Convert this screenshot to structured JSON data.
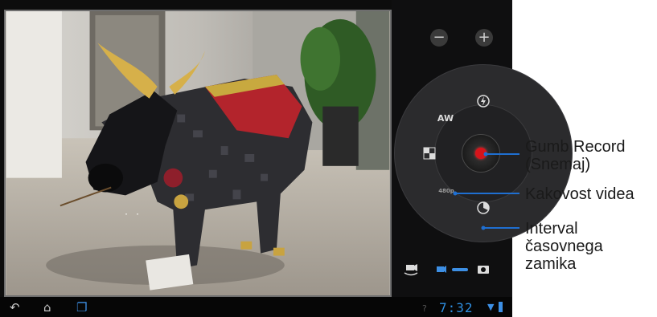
{
  "camera": {
    "zoom_out_label": "−",
    "zoom_in_label": "+",
    "focus_indicator": "· ·",
    "controls": {
      "flash_icon": "flash-auto-icon",
      "white_balance_label": "AW",
      "scene_icon": "color-effect-icon",
      "video_quality_label": "480p",
      "timelapse_icon": "timelapse-icon"
    },
    "mode": {
      "current": "video",
      "options": [
        "video",
        "photo"
      ]
    }
  },
  "status_bar": {
    "time": "7:32",
    "nav": [
      "back-icon",
      "home-icon",
      "recent-apps-icon"
    ]
  },
  "callouts": {
    "record": [
      "Gumb Record",
      "(Snemaj)"
    ],
    "quality": [
      "Kakovost videa"
    ],
    "timelapse": [
      "Interval",
      "časovnega",
      "zamika"
    ]
  },
  "colors": {
    "accent_line": "#1f6fd1",
    "record": "#d7141b",
    "clock": "#2f8fe0"
  }
}
